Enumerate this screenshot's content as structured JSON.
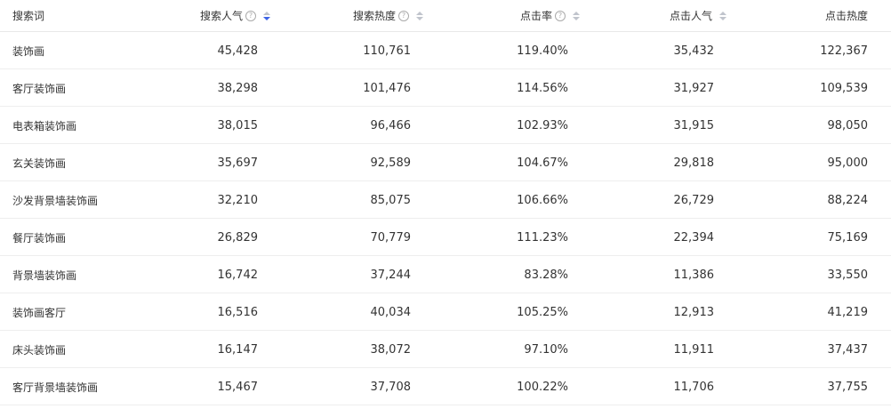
{
  "header": {
    "keyword": "搜索词",
    "search_popularity": "搜索人气",
    "search_heat": "搜索热度",
    "click_rate": "点击率",
    "click_popularity": "点击人气",
    "click_heat": "点击热度",
    "help_glyph": "?"
  },
  "rows": [
    {
      "keyword": "装饰画",
      "search_popularity": "45,428",
      "search_heat": "110,761",
      "click_rate": "119.40%",
      "click_popularity": "35,432",
      "click_heat": "122,367"
    },
    {
      "keyword": "客厅装饰画",
      "search_popularity": "38,298",
      "search_heat": "101,476",
      "click_rate": "114.56%",
      "click_popularity": "31,927",
      "click_heat": "109,539"
    },
    {
      "keyword": "电表箱装饰画",
      "search_popularity": "38,015",
      "search_heat": "96,466",
      "click_rate": "102.93%",
      "click_popularity": "31,915",
      "click_heat": "98,050"
    },
    {
      "keyword": "玄关装饰画",
      "search_popularity": "35,697",
      "search_heat": "92,589",
      "click_rate": "104.67%",
      "click_popularity": "29,818",
      "click_heat": "95,000"
    },
    {
      "keyword": "沙发背景墙装饰画",
      "search_popularity": "32,210",
      "search_heat": "85,075",
      "click_rate": "106.66%",
      "click_popularity": "26,729",
      "click_heat": "88,224"
    },
    {
      "keyword": "餐厅装饰画",
      "search_popularity": "26,829",
      "search_heat": "70,779",
      "click_rate": "111.23%",
      "click_popularity": "22,394",
      "click_heat": "75,169"
    },
    {
      "keyword": "背景墙装饰画",
      "search_popularity": "16,742",
      "search_heat": "37,244",
      "click_rate": "83.28%",
      "click_popularity": "11,386",
      "click_heat": "33,550"
    },
    {
      "keyword": "装饰画客厅",
      "search_popularity": "16,516",
      "search_heat": "40,034",
      "click_rate": "105.25%",
      "click_popularity": "12,913",
      "click_heat": "41,219"
    },
    {
      "keyword": "床头装饰画",
      "search_popularity": "16,147",
      "search_heat": "38,072",
      "click_rate": "97.10%",
      "click_popularity": "11,911",
      "click_heat": "37,437"
    },
    {
      "keyword": "客厅背景墙装饰画",
      "search_popularity": "15,467",
      "search_heat": "37,708",
      "click_rate": "100.22%",
      "click_popularity": "11,706",
      "click_heat": "37,755"
    }
  ],
  "colors": {
    "sort_active": "#3c63e6",
    "sort_inactive": "#c0c4cc",
    "row_border": "#eeeeee"
  }
}
